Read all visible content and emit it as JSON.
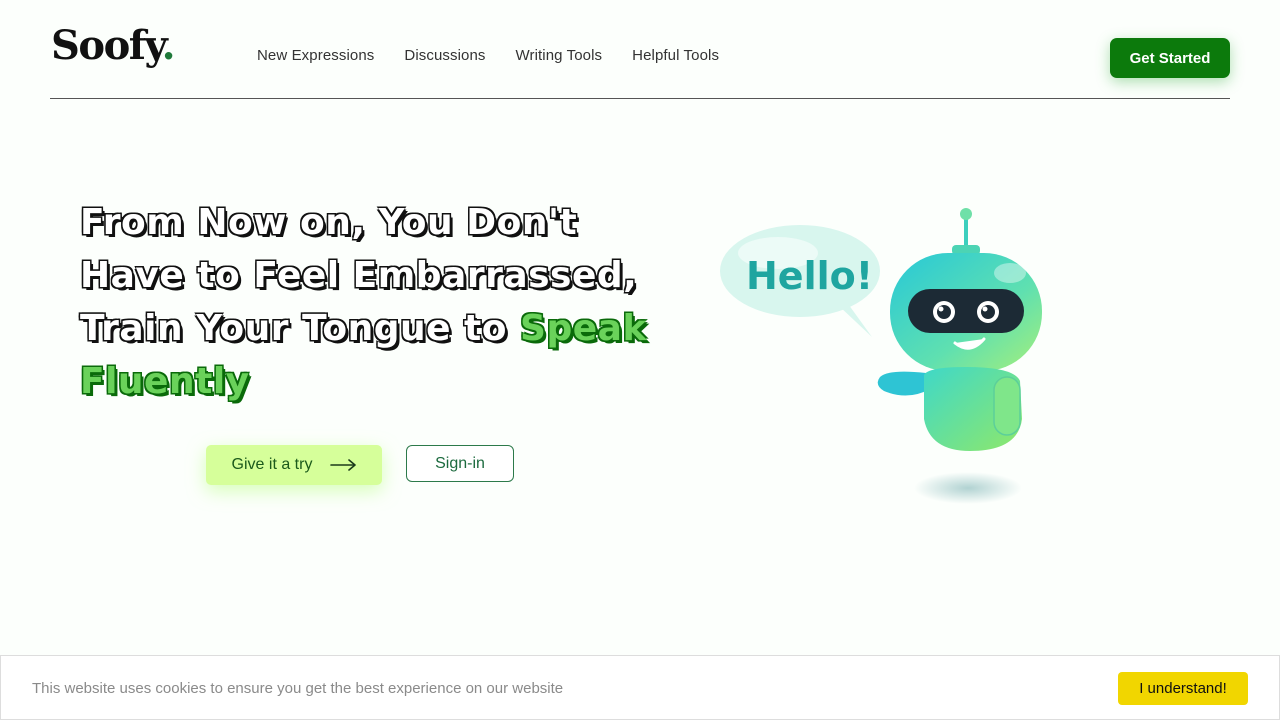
{
  "brand": {
    "name": "Soofy",
    "dot": "."
  },
  "nav": {
    "items": [
      {
        "label": "New Expressions"
      },
      {
        "label": "Discussions"
      },
      {
        "label": "Writing Tools"
      },
      {
        "label": "Helpful Tools"
      }
    ],
    "cta_label": "Get Started"
  },
  "hero": {
    "line1": "From Now on, You Don't",
    "line2": "Have to Feel Embarrassed,",
    "line3_plain": "Train Your Tongue to ",
    "accent": "Speak Fluently",
    "try_label": "Give it a try",
    "try_icon": "arrow-right-icon",
    "signin_label": "Sign-in"
  },
  "robot": {
    "bubble_text": "Hello!",
    "icon": "robot-mascot"
  },
  "cookie": {
    "message": "This website uses cookies to ensure you get the best experience on our website",
    "button_label": "I understand!"
  },
  "colors": {
    "brand_green": "#0c7a0c",
    "accent_green": "#6ad25a",
    "try_button": "#d6ff9a",
    "cookie_button": "#f1d600"
  }
}
